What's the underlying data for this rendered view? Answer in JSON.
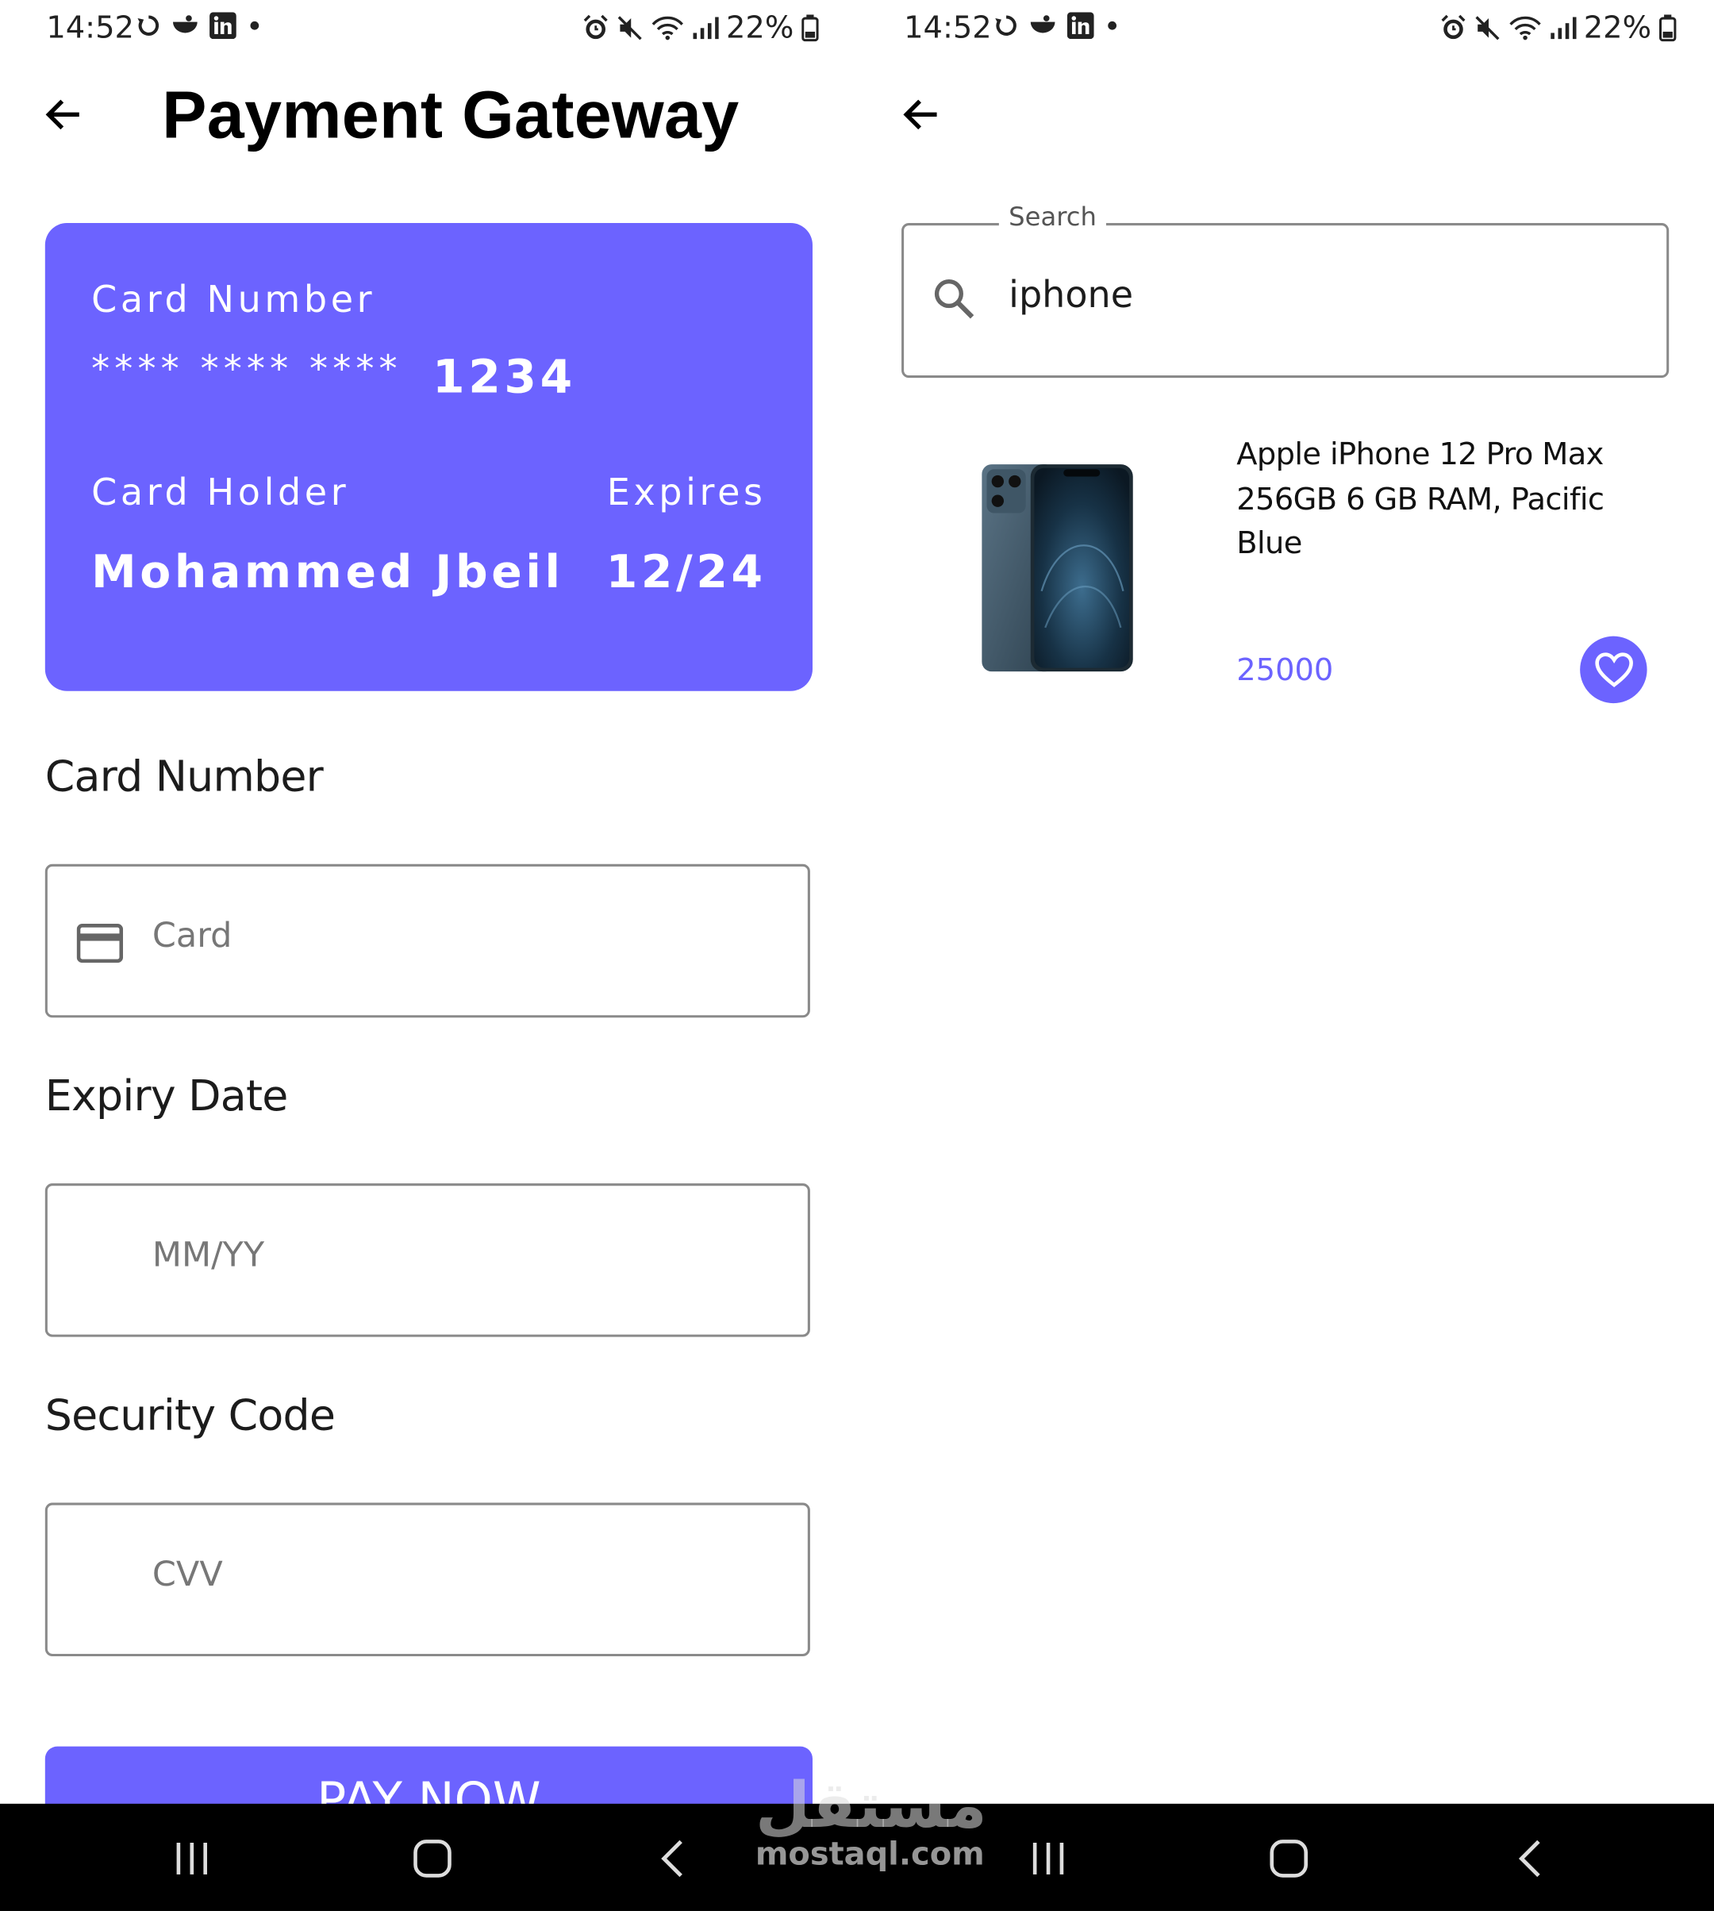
{
  "status_bar": {
    "time": "14:52",
    "battery": "22%"
  },
  "payment": {
    "title": "Payment Gateway",
    "card": {
      "number_label": "Card Number",
      "number_masked": "**** **** ****",
      "number_last4": "1234",
      "holder_label": "Card Holder",
      "holder_name": "Mohammed Jbeil",
      "expires_label": "Expires",
      "expires_value": "12/24",
      "color": "#6c63ff"
    },
    "fields": {
      "card_number_label": "Card Number",
      "card_placeholder": "Card",
      "expiry_label": "Expiry Date",
      "expiry_placeholder": "MM/YY",
      "security_label": "Security Code",
      "cvv_placeholder": "CVV"
    },
    "pay_button": "PAY NOW"
  },
  "search": {
    "legend": "Search",
    "value": "iphone",
    "results": [
      {
        "title": "Apple iPhone 12 Pro Max 256GB 6 GB RAM, Pacific Blue",
        "price": "25000",
        "icon": "heart-icon"
      }
    ]
  },
  "navbar": {
    "icons": [
      "recent-apps-icon",
      "home-icon",
      "back-icon"
    ]
  },
  "watermark": {
    "arabic": "مستقل",
    "latin": "mostaql.com"
  }
}
